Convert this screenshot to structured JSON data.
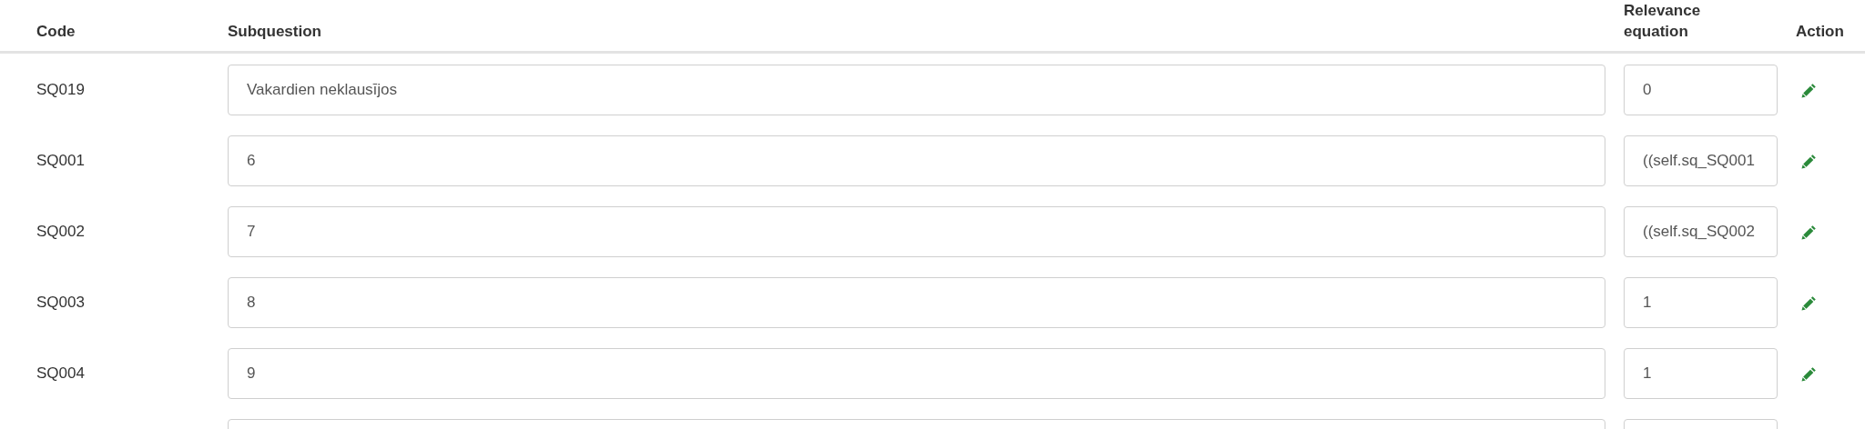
{
  "table": {
    "columns": [
      "Code",
      "Subquestion",
      "Relevance equation",
      "Action"
    ],
    "rows": [
      {
        "code": "SQ019",
        "subquestion": "Vakardien neklausījos",
        "relevance": "0"
      },
      {
        "code": "SQ001",
        "subquestion": "6",
        "relevance": "((self.sq_SQ001"
      },
      {
        "code": "SQ002",
        "subquestion": "7",
        "relevance": "((self.sq_SQ002"
      },
      {
        "code": "SQ003",
        "subquestion": "8",
        "relevance": "1"
      },
      {
        "code": "SQ004",
        "subquestion": "9",
        "relevance": "1"
      }
    ]
  }
}
